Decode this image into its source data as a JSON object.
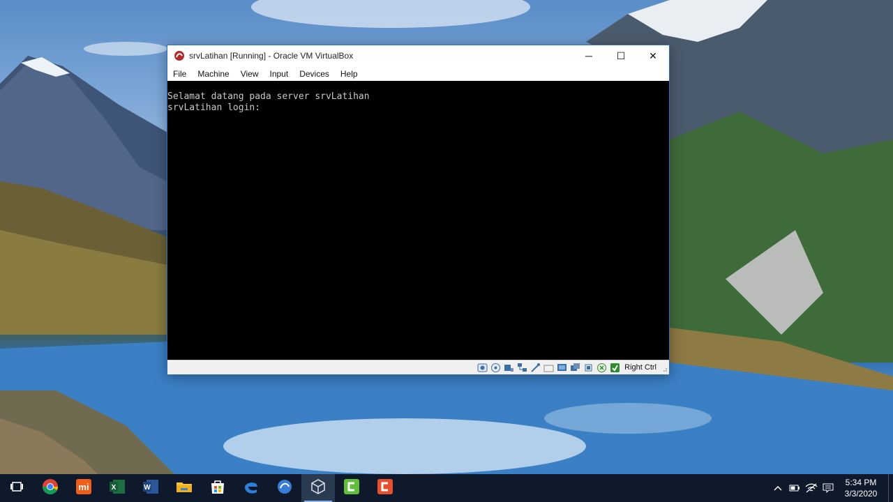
{
  "window": {
    "title": "srvLatihan [Running] - Oracle VM VirtualBox",
    "controls": {
      "minimize": "─",
      "maximize": "☐",
      "close": "✕"
    }
  },
  "menu": {
    "items": [
      "File",
      "Machine",
      "View",
      "Input",
      "Devices",
      "Help"
    ]
  },
  "console": {
    "lines": [
      "Selamat datang pada server srvLatihan",
      "srvLatihan login:"
    ]
  },
  "statusbar": {
    "icons": [
      "hard-disk-icon",
      "optical-drive-icon",
      "audio-icon",
      "network-icon",
      "usb-icon",
      "shared-folders-icon",
      "display-icon",
      "video-capture-icon",
      "cpu-icon",
      "mouse-integration-icon",
      "keyboard-capture-icon"
    ],
    "host_key": "Right Ctrl"
  },
  "taskbar": {
    "apps": [
      "task-view-icon",
      "chrome-icon",
      "mi-icon",
      "excel-icon",
      "word-icon",
      "file-explorer-icon",
      "store-icon",
      "edge-icon",
      "nemo-icon",
      "virtualbox-icon",
      "camtasia-green-icon",
      "camtasia-red-icon"
    ],
    "active_app": "virtualbox-icon",
    "clock_time": "5:34 PM",
    "clock_date": "3/3/2020"
  },
  "colors": {
    "console_bg": "#000000",
    "console_text": "#c8c8c8",
    "taskbar_bg": "#0e1a2b",
    "window_border": "#2b6fbf"
  }
}
